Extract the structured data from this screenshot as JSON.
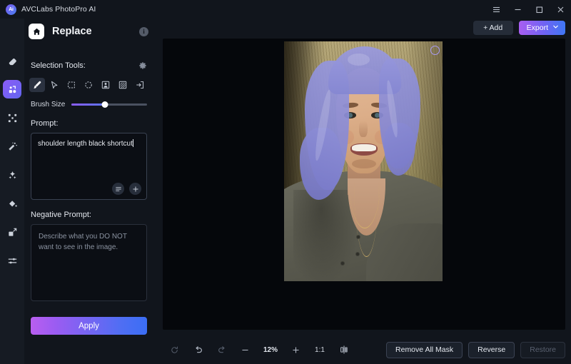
{
  "titlebar": {
    "app_name": "AVCLabs PhotoPro AI",
    "logo_text": "Ai",
    "menu_icon": "hamburger-menu-icon",
    "minimize_icon": "minimize-icon",
    "maximize_icon": "maximize-icon",
    "close_icon": "close-icon"
  },
  "rail": {
    "items": [
      {
        "name": "eraser-icon",
        "active": false
      },
      {
        "name": "replace-icon",
        "active": true
      },
      {
        "name": "expand-icon",
        "active": false
      },
      {
        "name": "magic-wand-icon",
        "active": false
      },
      {
        "name": "enhance-icon",
        "active": false
      },
      {
        "name": "paint-bucket-icon",
        "active": false
      },
      {
        "name": "resize-icon",
        "active": false
      },
      {
        "name": "adjust-sliders-icon",
        "active": false
      }
    ]
  },
  "panel": {
    "home_icon": "home-icon",
    "title": "Replace",
    "info_icon": "info-icon",
    "selection_tools_label": "Selection Tools:",
    "settings_icon": "gear-icon",
    "tools": [
      {
        "name": "brush-tool",
        "icon": "brush-icon",
        "active": true
      },
      {
        "name": "pointer-tool",
        "icon": "cursor-icon",
        "active": false
      },
      {
        "name": "rectangle-select-tool",
        "icon": "square-dashed-icon",
        "active": false
      },
      {
        "name": "ellipse-select-tool",
        "icon": "circle-dashed-icon",
        "active": false
      },
      {
        "name": "subject-select-tool",
        "icon": "person-box-icon",
        "active": false
      },
      {
        "name": "background-select-tool",
        "icon": "hatched-box-icon",
        "active": false
      },
      {
        "name": "import-mask-tool",
        "icon": "arrow-into-box-icon",
        "active": false
      }
    ],
    "brush_size_label": "Brush Size",
    "brush_size_value": "44",
    "prompt_label": "Prompt:",
    "prompt_value": "shoulder length black shortcut",
    "prompt_list_icon": "list-icon",
    "prompt_add_icon": "plus-icon",
    "negative_prompt_label": "Negative Prompt:",
    "negative_prompt_value": "",
    "negative_prompt_placeholder": "Describe what you DO NOT want to see in the image.",
    "apply_label": "Apply"
  },
  "workspace": {
    "add_label": "+ Add",
    "export_label": "Export",
    "export_chevron_icon": "chevron-down-icon",
    "canvas": {
      "brush_cursor_icon": "brush-cursor-circle"
    },
    "zoombar": {
      "reset_icon": "reset-icon",
      "undo_icon": "undo-icon",
      "redo_icon": "redo-icon",
      "zoom_out_icon": "minus-icon",
      "zoom_level": "12%",
      "zoom_in_icon": "plus-icon",
      "actual_size_label": "1:1",
      "compare_icon": "split-compare-icon"
    },
    "actions": {
      "remove_all_mask_label": "Remove All Mask",
      "reverse_label": "Reverse",
      "restore_label": "Restore"
    }
  },
  "colors": {
    "accent_purple": "#8b5cf6",
    "accent_blue": "#3f77f5",
    "mask_overlay": "#8d8ed6",
    "panel_bg": "#11151c",
    "rail_bg": "#161b23",
    "canvas_bg": "#05070b"
  }
}
